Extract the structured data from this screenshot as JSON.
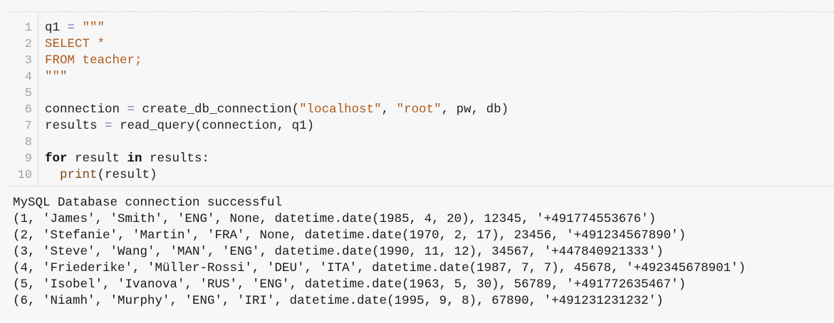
{
  "code_cell": {
    "lines": [
      {
        "no": "1",
        "parts": [
          {
            "t": "q1 ",
            "c": "plain"
          },
          {
            "t": "=",
            "c": "op"
          },
          {
            "t": " \"\"\"",
            "c": "str"
          }
        ]
      },
      {
        "no": "2",
        "parts": [
          {
            "t": "SELECT *",
            "c": "str"
          }
        ]
      },
      {
        "no": "3",
        "parts": [
          {
            "t": "FROM teacher;",
            "c": "str"
          }
        ]
      },
      {
        "no": "4",
        "parts": [
          {
            "t": "\"\"\"",
            "c": "str"
          }
        ]
      },
      {
        "no": "5",
        "parts": []
      },
      {
        "no": "6",
        "parts": [
          {
            "t": "connection ",
            "c": "plain"
          },
          {
            "t": "=",
            "c": "op"
          },
          {
            "t": " create_db_connection(",
            "c": "plain"
          },
          {
            "t": "\"localhost\"",
            "c": "str"
          },
          {
            "t": ", ",
            "c": "plain"
          },
          {
            "t": "\"root\"",
            "c": "str"
          },
          {
            "t": ", pw, db)",
            "c": "plain"
          }
        ]
      },
      {
        "no": "7",
        "parts": [
          {
            "t": "results ",
            "c": "plain"
          },
          {
            "t": "=",
            "c": "op"
          },
          {
            "t": " read_query(connection, q1)",
            "c": "plain"
          }
        ]
      },
      {
        "no": "8",
        "parts": []
      },
      {
        "no": "9",
        "parts": [
          {
            "t": "for",
            "c": "kw"
          },
          {
            "t": " result ",
            "c": "plain"
          },
          {
            "t": "in",
            "c": "kw"
          },
          {
            "t": " results:",
            "c": "plain"
          }
        ]
      },
      {
        "no": "10",
        "parts": [
          {
            "t": "  ",
            "c": "plain"
          },
          {
            "t": "print",
            "c": "bi"
          },
          {
            "t": "(result)",
            "c": "plain"
          }
        ]
      }
    ]
  },
  "output": {
    "lines": [
      "MySQL Database connection successful",
      "(1, 'James', 'Smith', 'ENG', None, datetime.date(1985, 4, 20), 12345, '+491774553676')",
      "(2, 'Stefanie', 'Martin', 'FRA', None, datetime.date(1970, 2, 17), 23456, '+491234567890')",
      "(3, 'Steve', 'Wang', 'MAN', 'ENG', datetime.date(1990, 11, 12), 34567, '+447840921333')",
      "(4, 'Friederike', 'Müller-Rossi', 'DEU', 'ITA', datetime.date(1987, 7, 7), 45678, '+492345678901')",
      "(5, 'Isobel', 'Ivanova', 'RUS', 'ENG', datetime.date(1963, 5, 30), 56789, '+491772635467')",
      "(6, 'Niamh', 'Murphy', 'ENG', 'IRI', datetime.date(1995, 9, 8), 67890, '+491231231232')"
    ]
  }
}
